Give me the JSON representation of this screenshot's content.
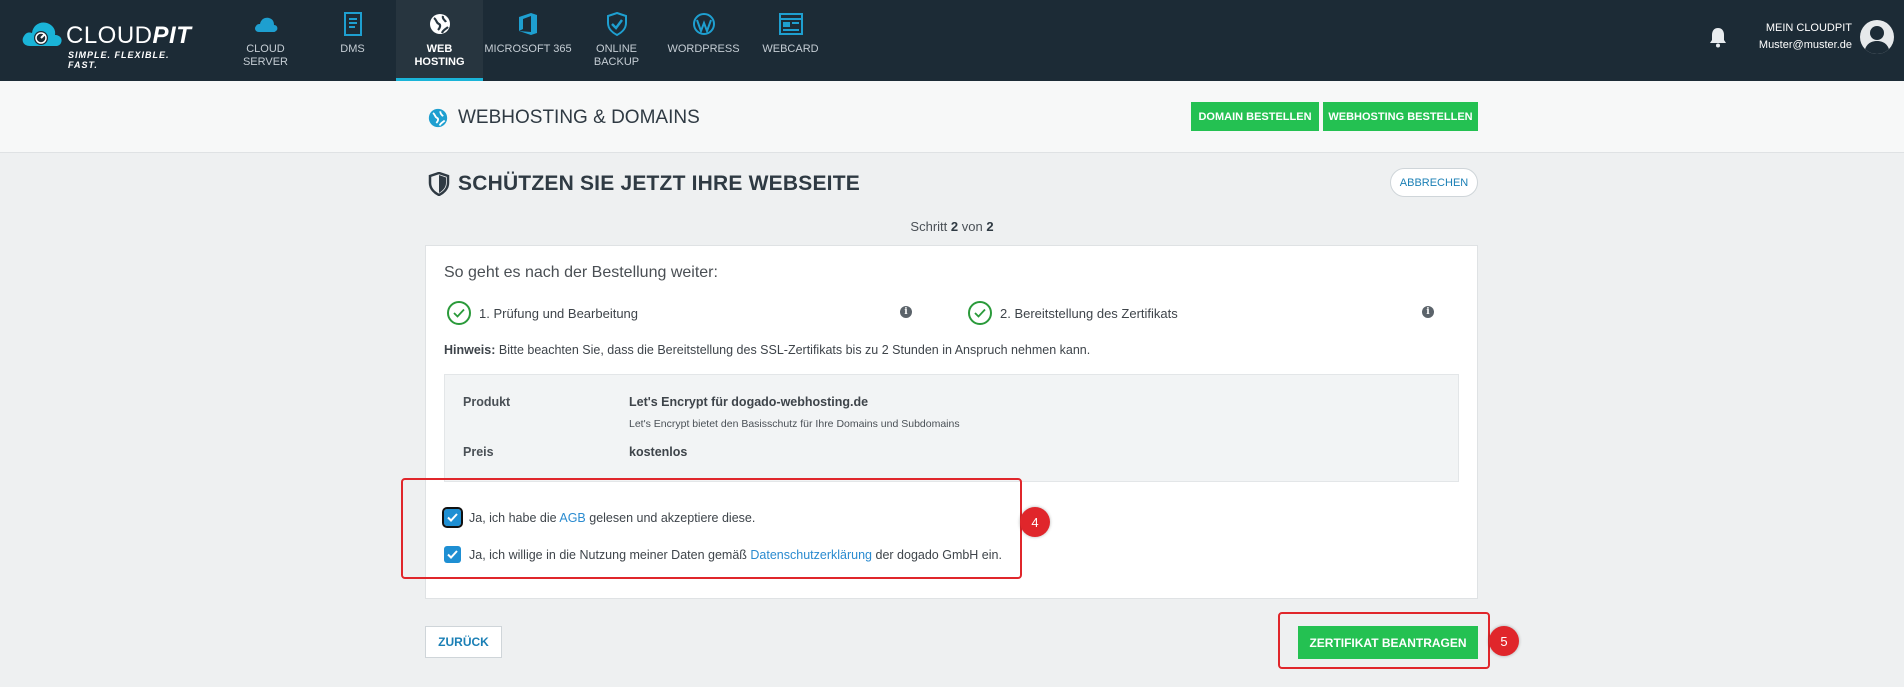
{
  "brand": {
    "name_light": "CLOUD",
    "name_bold": "PIT",
    "tagline": "SIMPLE. FLEXIBLE. FAST."
  },
  "nav": {
    "items": [
      {
        "label_1": "CLOUD",
        "label_2": "SERVER",
        "icon": "cloud-icon"
      },
      {
        "label_1": "DMS",
        "label_2": "",
        "icon": "document-icon"
      },
      {
        "label_1": "WEB",
        "label_2": "HOSTING",
        "icon": "globe-icon"
      },
      {
        "label_1": "MICROSOFT 365",
        "label_2": "",
        "icon": "office-icon"
      },
      {
        "label_1": "ONLINE",
        "label_2": "BACKUP",
        "icon": "shield-icon"
      },
      {
        "label_1": "WORDPRESS",
        "label_2": "",
        "icon": "wordpress-icon"
      },
      {
        "label_1": "WEBCARD",
        "label_2": "",
        "icon": "webcard-icon"
      }
    ]
  },
  "account": {
    "label": "MEIN CLOUDPIT",
    "email": "Muster@muster.de"
  },
  "subheader": {
    "title": "WEBHOSTING & DOMAINS",
    "domain_button": "DOMAIN BESTELLEN",
    "webhosting_button": "WEBHOSTING BESTELLEN"
  },
  "page": {
    "title": "SCHÜTZEN SIE JETZT IHRE WEBSEITE",
    "cancel_button": "ABBRECHEN",
    "step_prefix": "Schritt",
    "step_current": "2",
    "step_mid": "von",
    "step_total": "2"
  },
  "card": {
    "heading": "So geht es nach der Bestellung weiter:",
    "step1": "1. Prüfung und Bearbeitung",
    "step2": "2. Bereitstellung des Zertifikats",
    "hint_label": "Hinweis:",
    "hint_text": "Bitte beachten Sie, dass die Bereitstellung des SSL-Zertifikats bis zu 2 Stunden in Anspruch nehmen kann.",
    "product_label": "Produkt",
    "product_value": "Let's Encrypt für dogado-webhosting.de",
    "product_sub": "Let's Encrypt bietet den Basisschutz für Ihre Domains und Subdomains",
    "price_label": "Preis",
    "price_value": "kostenlos",
    "agb_pre": "Ja, ich habe die",
    "agb_link": "AGB",
    "agb_post": "gelesen und akzeptiere diese.",
    "privacy_pre": "Ja, ich willige in die Nutzung meiner Daten gemäß",
    "privacy_link": "Datenschutzerklärung",
    "privacy_post": "der dogado GmbH ein."
  },
  "markers": {
    "m4": "4",
    "m5": "5"
  },
  "footer": {
    "back_button": "ZURÜCK",
    "submit_button": "ZERTIFIKAT BEANTRAGEN"
  }
}
